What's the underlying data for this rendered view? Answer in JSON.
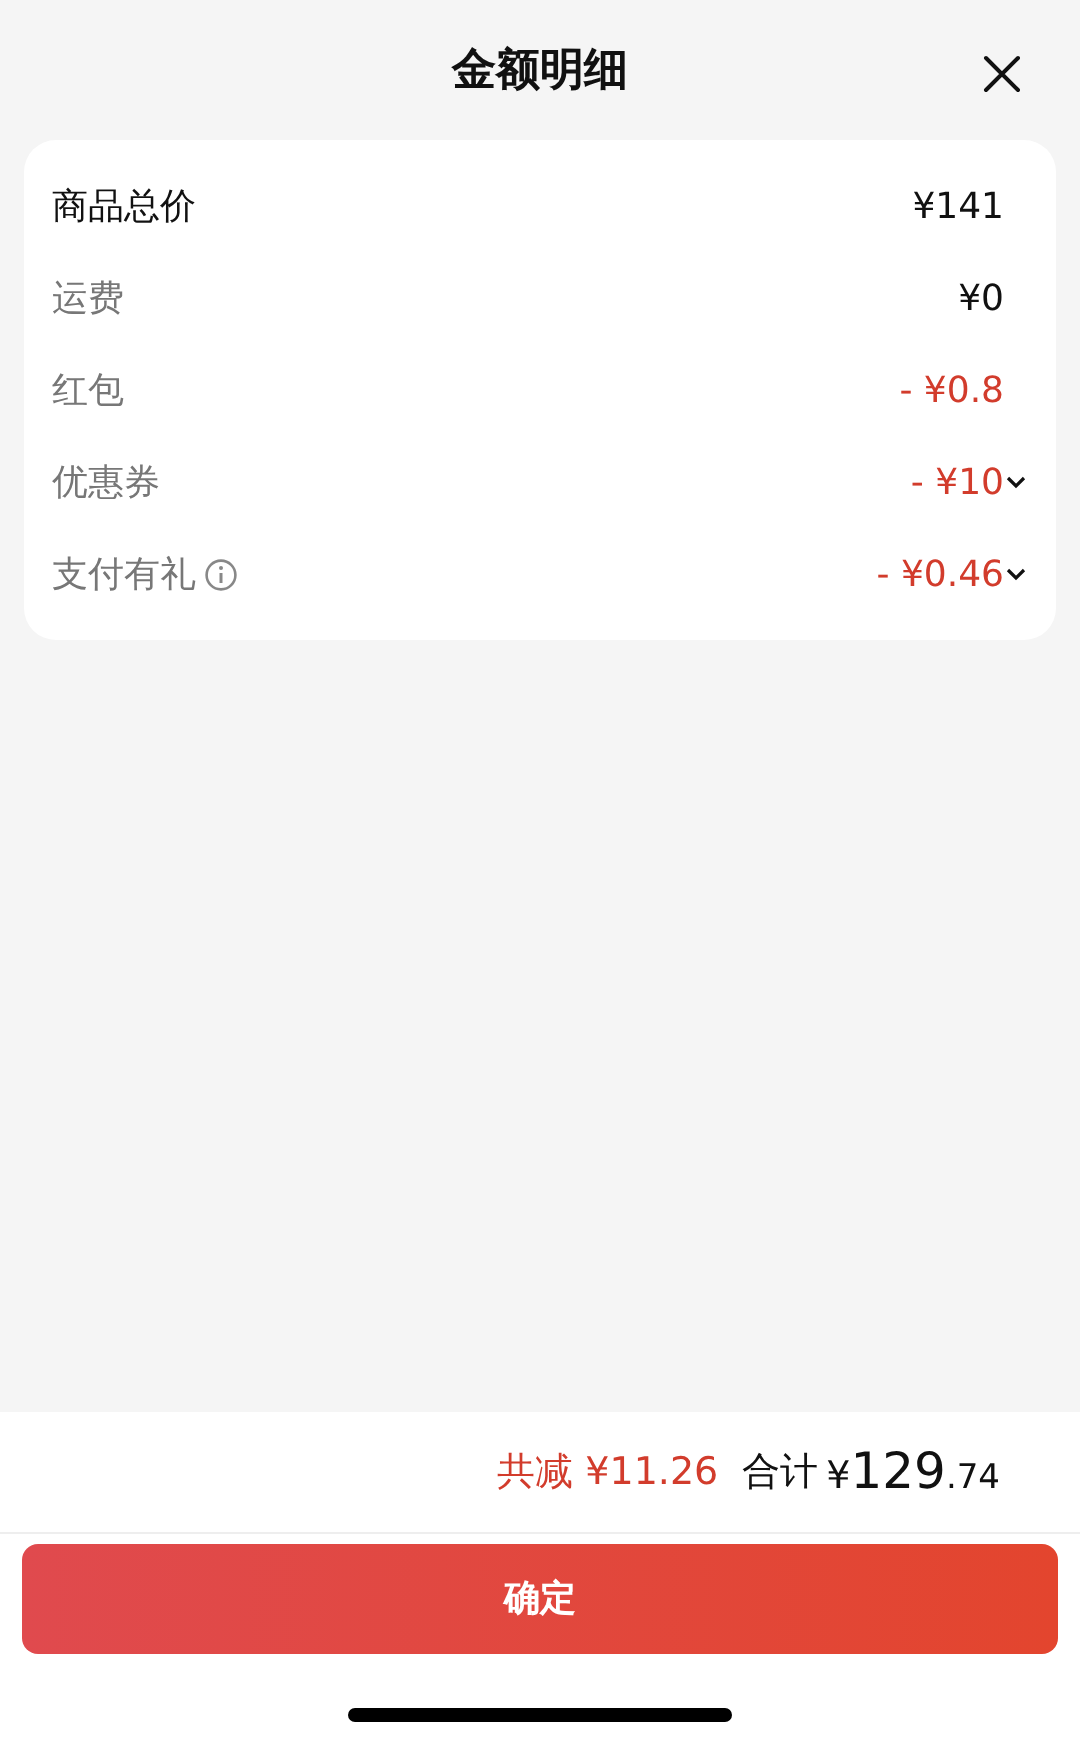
{
  "header": {
    "title": "金额明细"
  },
  "rows": [
    {
      "label": "商品总价",
      "amount": "¥141",
      "kind": "total",
      "info": false,
      "expandable": false
    },
    {
      "label": "运费",
      "amount": "¥0",
      "kind": "plain",
      "info": false,
      "expandable": false
    },
    {
      "label": "红包",
      "amount": "- ¥0.8",
      "kind": "discount",
      "info": false,
      "expandable": false
    },
    {
      "label": "优惠券",
      "amount": "- ¥10",
      "kind": "discount",
      "info": false,
      "expandable": true
    },
    {
      "label": "支付有礼",
      "amount": "- ¥0.46",
      "kind": "discount",
      "info": true,
      "expandable": true
    }
  ],
  "footer": {
    "savings": "共减 ¥11.26",
    "total_label": "合计",
    "total_amount": {
      "currency": "¥",
      "integer": "129",
      "fraction": ".74"
    },
    "confirm_button": "确定"
  }
}
